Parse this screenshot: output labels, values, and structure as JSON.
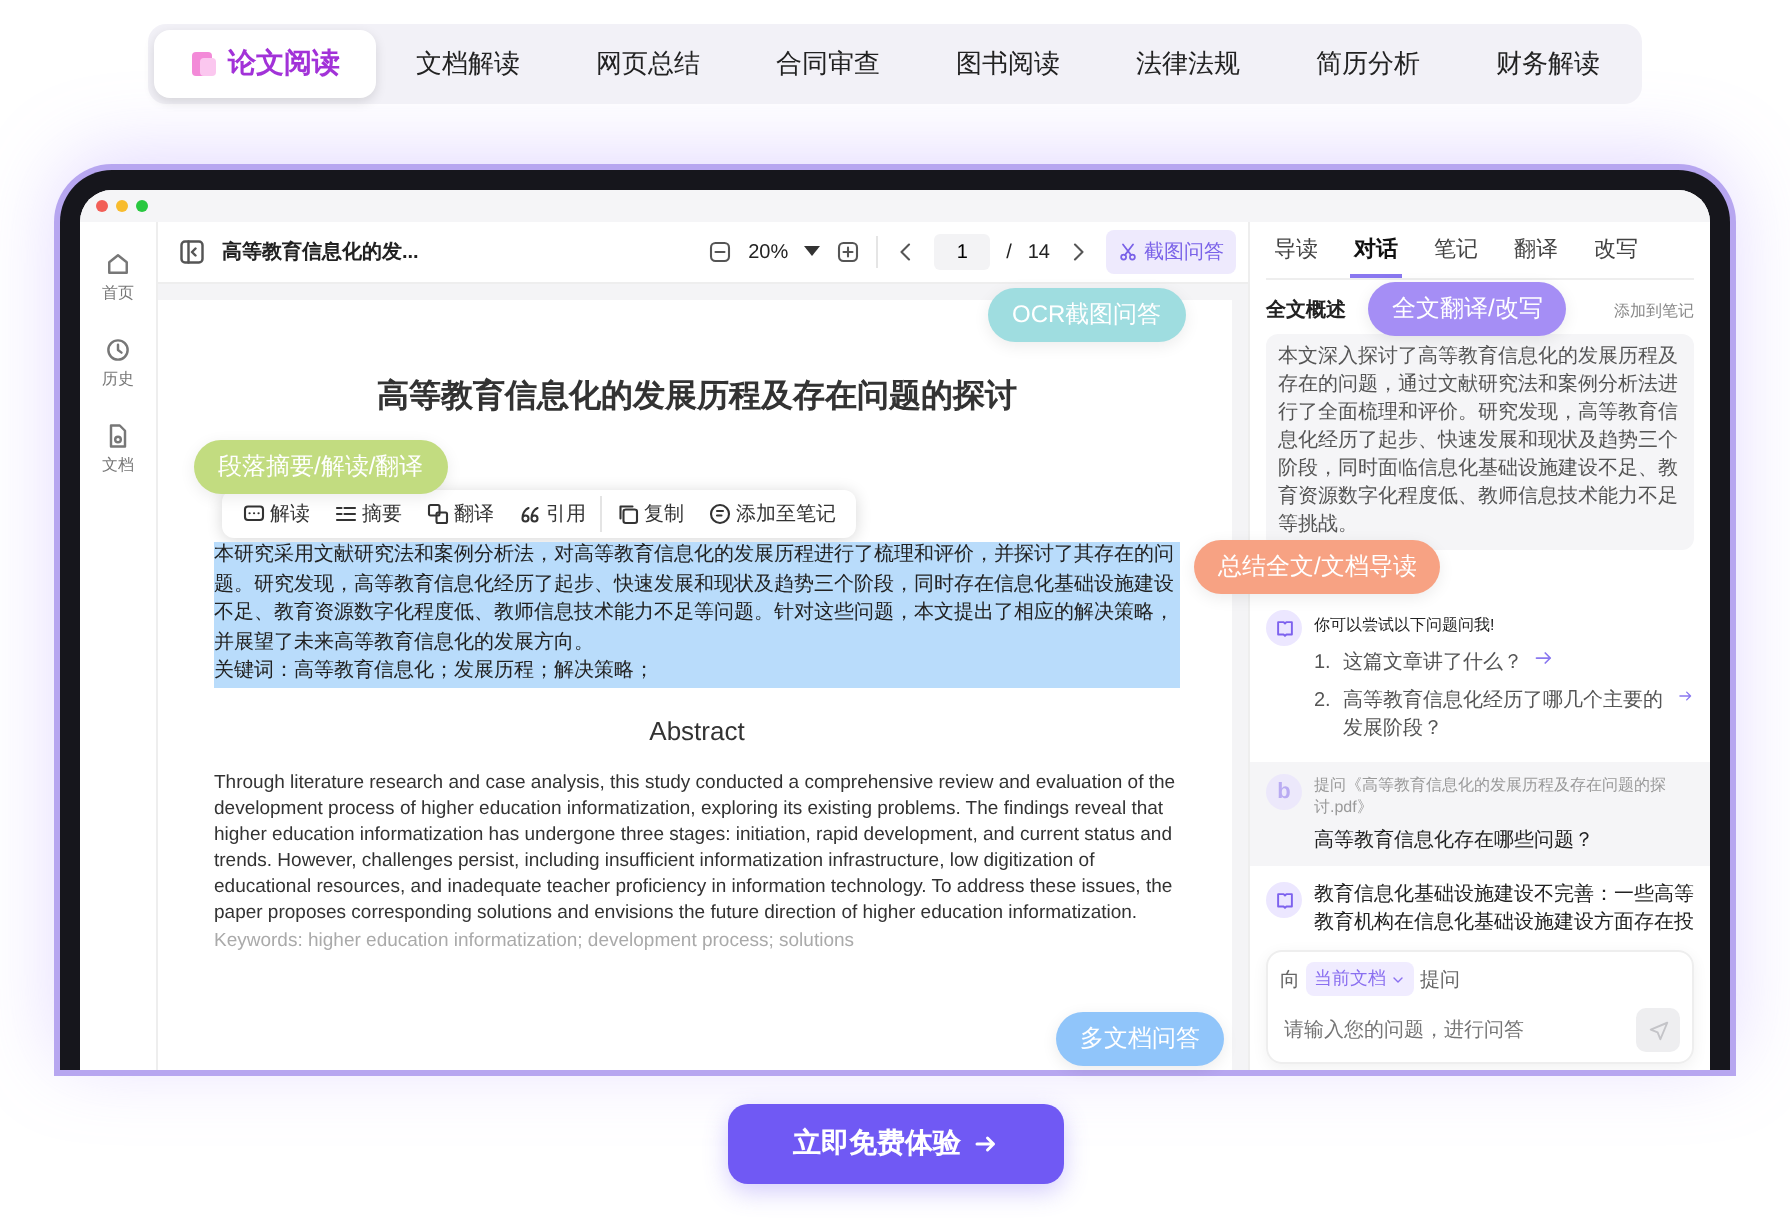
{
  "feature_tabs": [
    {
      "label": "论文阅读",
      "selected": true
    },
    {
      "label": "文档解读",
      "selected": false
    },
    {
      "label": "网页总结",
      "selected": false
    },
    {
      "label": "合同审查",
      "selected": false
    },
    {
      "label": "图书阅读",
      "selected": false
    },
    {
      "label": "法律法规",
      "selected": false
    },
    {
      "label": "简历分析",
      "selected": false
    },
    {
      "label": "财务解读",
      "selected": false
    }
  ],
  "app": {
    "nav": [
      {
        "kind": "home",
        "label": "首页"
      },
      {
        "kind": "history",
        "label": "历史"
      },
      {
        "kind": "docs",
        "label": "文档"
      }
    ],
    "toolbar": {
      "file_name": "高等教育信息化的发...",
      "zoom": "20%",
      "page": "1",
      "page_separator": "/",
      "page_count": "14",
      "snip_button": "截图问答"
    },
    "document": {
      "title": "高等教育信息化的发展历程及存在问题的探讨",
      "selection_toolbar": [
        {
          "kind": "explain",
          "label": "解读"
        },
        {
          "kind": "summary",
          "label": "摘要"
        },
        {
          "kind": "translate",
          "label": "翻译"
        },
        {
          "kind": "quote",
          "label": "引用"
        },
        {
          "kind": "copy",
          "label": "复制"
        },
        {
          "kind": "note",
          "label": "添加至笔记"
        }
      ],
      "abstract_cn": {
        "text": "本研究采用文献研究法和案例分析法，对高等教育信息化的发展历程进行了梳理和评价，并探讨了其存在的问题。研究发现，高等教育信息化经历了起步、快速发展和现状及趋势三个阶段，同时存在信息化基础设施建设不足、教育资源数字化程度低、教师信息技术能力不足等问题。针对这些问题，本文提出了相应的解决策略，并展望了未来高等教育信息化的发展方向。",
        "highlighted": true
      },
      "keywords_cn": {
        "text": "关键词：高等教育信息化；发展历程；解决策略；",
        "highlighted": true
      },
      "abstract_heading": "Abstract",
      "abstract_en": "Through literature research and case analysis, this study conducted a comprehensive review and evaluation of the development process of higher education informatization, exploring its existing problems. The findings reveal that higher education informatization has undergone three stages: initiation, rapid development, and current status and trends. However, challenges persist, including insufficient informatization infrastructure, low digitization of educational resources, and inadequate teacher proficiency in information technology. To address these issues, the paper proposes corresponding solutions and envisions the future direction of higher education informatization.",
      "keywords_en": "Keywords: higher education informatization; development process; solutions"
    },
    "panel": {
      "tabs": [
        {
          "label": "导读",
          "selected": false
        },
        {
          "label": "对话",
          "selected": true
        },
        {
          "label": "笔记",
          "selected": false
        },
        {
          "label": "翻译",
          "selected": false
        },
        {
          "label": "改写",
          "selected": false
        }
      ],
      "summary_label": "全文概述",
      "add_note": "添加到笔记",
      "summary": "本文深入探讨了高等教育信息化的发展历程及存在的问题，通过文献研究法和案例分析法进行了全面梳理和评价。研究发现，高等教育信息化经历了起步、快速发展和现状及趋势三个阶段，同时面临信息化基础设施建设不足、教育资源数字化程度低、教师信息技术能力不足等挑战。",
      "suggestion": {
        "intro": "你可以尝试以下问题问我!",
        "questions": [
          {
            "number": "1.",
            "text": "这篇文章讲了什么？"
          },
          {
            "number": "2.",
            "text": "高等教育信息化经历了哪几个主要的发展阶段？"
          }
        ]
      },
      "user_message": {
        "avatar": "b",
        "context": "提问《高等教育信息化的发展历程及存在问题的探讨.pdf》",
        "text": "高等教育信息化存在哪些问题？"
      },
      "answer": "教育信息化基础设施建设不完善：一些高等教育机构在信息化基础设施建设方面存在投",
      "composer": {
        "prefix": "向",
        "scope": "当前文档",
        "suffix": "提问",
        "placeholder": "请输入您的问题，进行问答",
        "send_disabled": true
      }
    }
  },
  "bubbles": [
    {
      "label": "OCR截图问答",
      "color": "#9fdde0"
    },
    {
      "label": "全文翻译/改写",
      "color": "#a58ef5"
    },
    {
      "label": "段落摘要/解读/翻译",
      "color": "#c2dc80"
    },
    {
      "label": "总结全文/文档导读",
      "color": "#f7a283"
    },
    {
      "label": "多文档问答",
      "color": "#90c5fa"
    }
  ],
  "cta": "立即免费体验"
}
